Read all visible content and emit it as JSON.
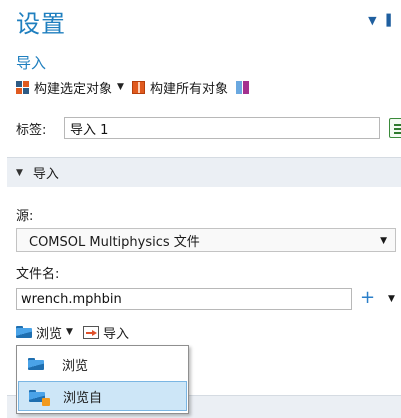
{
  "header": {
    "title": "设置",
    "subtitle": "导入"
  },
  "toolbar": {
    "build_selected": "构建选定对象",
    "build_all": "构建所有对象"
  },
  "label_field": {
    "label": "标签:",
    "value": "导入 1"
  },
  "section": {
    "title": "导入"
  },
  "source": {
    "label": "源:",
    "selected": "COMSOL Multiphysics 文件"
  },
  "filename": {
    "label": "文件名:",
    "value": "wrench.mphbin"
  },
  "actions": {
    "browse": "浏览",
    "import": "导入"
  },
  "browse_menu": {
    "items": [
      {
        "label": "浏览"
      },
      {
        "label": "浏览自"
      }
    ]
  },
  "colors": {
    "accent": "#1f7fbf",
    "section_bg": "#ebeff4",
    "menu_hover": "#cde6f7"
  }
}
